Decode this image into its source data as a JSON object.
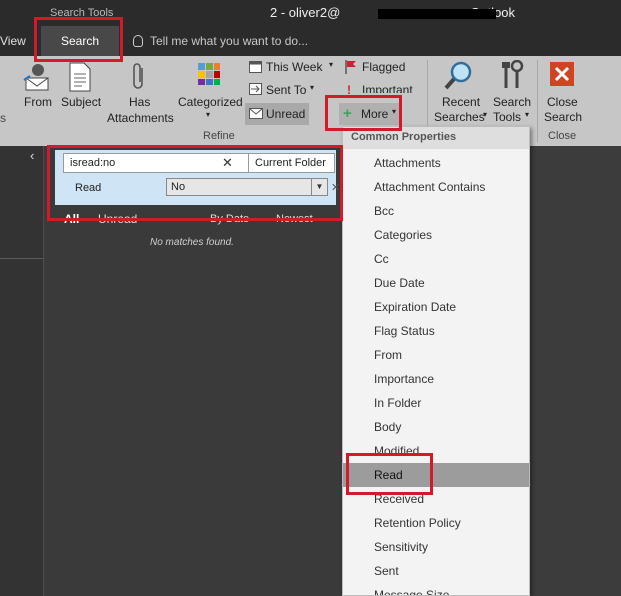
{
  "window": {
    "context_tab_label": "Search Tools",
    "title": "2 - oliver2@",
    "title_suffix": "- Outlook"
  },
  "tabs": {
    "view": "View",
    "search": "Search"
  },
  "tell_me": {
    "placeholder": "Tell me what you want to do..."
  },
  "ribbon": {
    "from": "From",
    "subject": "Subject",
    "has_attachments": [
      "Has",
      "Attachments"
    ],
    "categorized": "Categorized",
    "this_week": "This Week",
    "sent_to": "Sent To",
    "unread": "Unread",
    "flagged": "Flagged",
    "important": "Important",
    "more": "More",
    "refine_group": "Refine",
    "recent_searches": [
      "Recent",
      "Searches"
    ],
    "search_tools": [
      "Search",
      "Tools"
    ],
    "close_search": [
      "Close",
      "Search"
    ],
    "close_group": "Close"
  },
  "search": {
    "query": "isread:no",
    "scope": "Current Folder",
    "criteria_label": "Read",
    "criteria_value": "No"
  },
  "list": {
    "filter_all": "All",
    "filter_unread": "Unread",
    "sort_by": "By Date",
    "sort_order": "Newest",
    "empty_message": "No matches found."
  },
  "more_menu": {
    "header": "Common Properties",
    "items": [
      "Attachments",
      "Attachment Contains",
      "Bcc",
      "Categories",
      "Cc",
      "Due Date",
      "Expiration Date",
      "Flag Status",
      "From",
      "Importance",
      "In Folder",
      "Body",
      "Modified",
      "Read",
      "Received",
      "Retention Policy",
      "Sensitivity",
      "Sent",
      "Message Size"
    ],
    "selected": "Read"
  },
  "colors": {
    "highlight": "#d21a2b",
    "ribbon": "#c6c6c6",
    "dark": "#2b2b2b"
  }
}
